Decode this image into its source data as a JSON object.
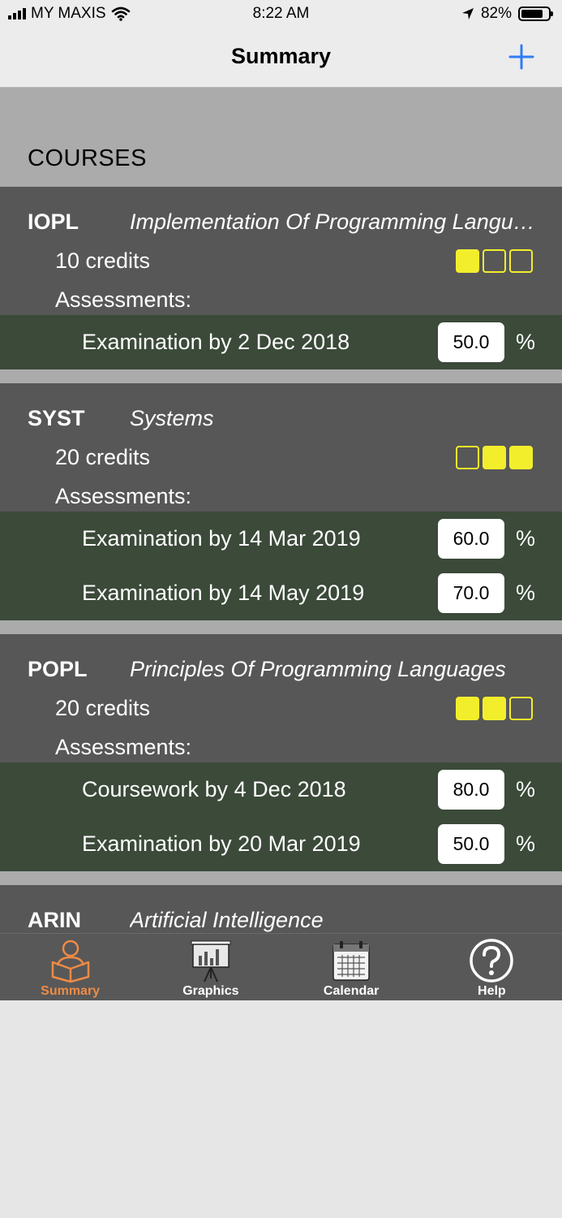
{
  "status_bar": {
    "carrier": "MY MAXIS",
    "time": "8:22 AM",
    "battery": "82%",
    "battery_level": 0.82
  },
  "nav": {
    "title": "Summary",
    "add_icon": "plus-icon",
    "accent_color": "#2f7cf6"
  },
  "section": {
    "title": "COURSES"
  },
  "courses": [
    {
      "code": "IOPL",
      "name": "Implementation Of Programming Languages",
      "credits": "10 credits",
      "progress": [
        true,
        false,
        false
      ],
      "assessments_label": "Assessments:",
      "assessments": [
        {
          "text": "Examination by 2 Dec 2018",
          "value": "50.0",
          "unit": "%"
        }
      ]
    },
    {
      "code": "SYST",
      "name": "Systems",
      "credits": "20 credits",
      "progress": [
        false,
        true,
        true
      ],
      "assessments_label": "Assessments:",
      "assessments": [
        {
          "text": "Examination by 14 Mar 2019",
          "value": "60.0",
          "unit": "%"
        },
        {
          "text": "Examination by 14 May 2019",
          "value": "70.0",
          "unit": "%"
        }
      ]
    },
    {
      "code": "POPL",
      "name": "Principles Of Programming Languages",
      "credits": "20 credits",
      "progress": [
        true,
        true,
        false
      ],
      "assessments_label": "Assessments:",
      "assessments": [
        {
          "text": "Coursework by 4 Dec 2018",
          "value": "80.0",
          "unit": "%"
        },
        {
          "text": "Examination by 20 Mar 2019",
          "value": "50.0",
          "unit": "%"
        }
      ]
    },
    {
      "code": "ARIN",
      "name": "Artificial Intelligence"
    }
  ],
  "tabs": [
    {
      "label": "Summary",
      "icon": "reading-person-icon",
      "active": true
    },
    {
      "label": "Graphics",
      "icon": "chart-easel-icon",
      "active": false
    },
    {
      "label": "Calendar",
      "icon": "calendar-icon",
      "active": false
    },
    {
      "label": "Help",
      "icon": "help-circle-icon",
      "active": false
    }
  ],
  "colors": {
    "course_bg": "#575757",
    "assessment_bg": "#3b4a39",
    "progress_yellow": "#f3ee2c",
    "tab_active": "#ee8b45"
  }
}
